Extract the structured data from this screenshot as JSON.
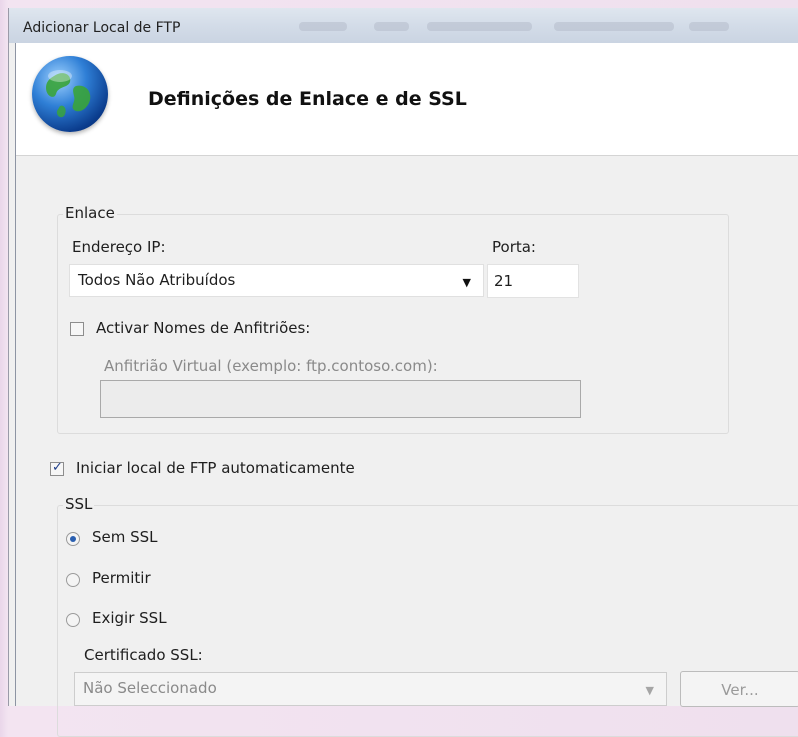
{
  "window": {
    "title": "Adicionar Local de FTP"
  },
  "header": {
    "icon": "globe-icon",
    "title": "Definições de Enlace e de SSL"
  },
  "binding": {
    "group_label": "Enlace",
    "ip_label": "Endereço IP:",
    "ip_value": "Todos Não Atribuídos",
    "port_label": "Porta:",
    "port_value": "21",
    "hostnames_checkbox_label": "Activar Nomes de Anfitriões:",
    "hostnames_checked": false,
    "virtual_host_label": "Anfitrião Virtual (exemplo: ftp.contoso.com):",
    "virtual_host_value": ""
  },
  "autostart": {
    "label": "Iniciar local de FTP automaticamente",
    "checked": true
  },
  "ssl": {
    "group_label": "SSL",
    "options": [
      {
        "label": "Sem SSL",
        "selected": true
      },
      {
        "label": "Permitir",
        "selected": false
      },
      {
        "label": "Exigir SSL",
        "selected": false
      }
    ],
    "certificate_label": "Certificado SSL:",
    "certificate_value": "Não Seleccionado",
    "view_button_label": "Ver..."
  },
  "colors": {
    "titlebar": "#d3dce8",
    "dialog_bg": "#f0f0f0",
    "accent": "#2a5fb0",
    "disabled_text": "#8a8a8a"
  }
}
